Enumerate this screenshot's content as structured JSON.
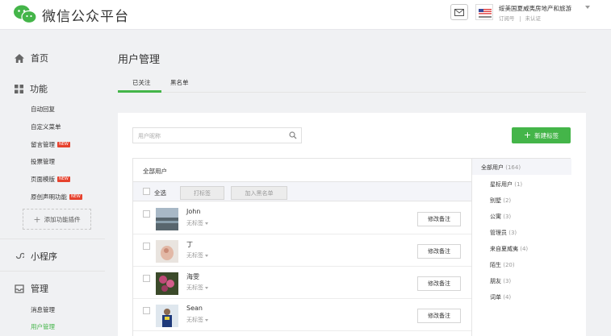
{
  "header": {
    "title": "微信公众平台",
    "account_name": "绥美国夏威夷房地产和旅游",
    "account_type": "订阅号",
    "account_status": "未认证"
  },
  "sidebar": {
    "home": "首页",
    "features": "功能",
    "feature_items": [
      {
        "label": "自动回复"
      },
      {
        "label": "自定义菜单"
      },
      {
        "label": "留言管理",
        "badge": "NEW"
      },
      {
        "label": "投票管理"
      },
      {
        "label": "页面模版",
        "badge": "NEW"
      },
      {
        "label": "原创声明功能",
        "badge": "NEW"
      }
    ],
    "add_plugin": "添加功能插件",
    "mini_program": "小程序",
    "manage": "管理",
    "manage_items": [
      {
        "label": "消息管理"
      },
      {
        "label": "用户管理"
      }
    ]
  },
  "main": {
    "title": "用户管理",
    "tabs": [
      "已关注",
      "黑名单"
    ],
    "search_placeholder": "用户昵称",
    "new_tag_button": "新建标签",
    "list_title": "全部用户",
    "select_all": "全选",
    "tag_button": "打标签",
    "blacklist_button": "加入黑名单",
    "users": [
      {
        "name": "John",
        "tag": "无标签",
        "action": "修改备注"
      },
      {
        "name": "丁",
        "tag": "无标签",
        "action": "修改备注"
      },
      {
        "name": "海雯",
        "tag": "无标签",
        "action": "修改备注"
      },
      {
        "name": "Sean",
        "tag": "无标签",
        "action": "修改备注"
      }
    ]
  },
  "tag_panel": {
    "all_label": "全部用户",
    "all_count": "(164)",
    "tags": [
      {
        "name": "星标用户",
        "count": "(1)"
      },
      {
        "name": "别墅",
        "count": "(2)"
      },
      {
        "name": "公寓",
        "count": "(3)"
      },
      {
        "name": "管理员",
        "count": "(3)"
      },
      {
        "name": "来自夏威夷",
        "count": "(4)"
      },
      {
        "name": "陌生",
        "count": "(20)"
      },
      {
        "name": "朋友",
        "count": "(3)"
      },
      {
        "name": "词单",
        "count": "(4)"
      }
    ]
  },
  "colors": {
    "accent": "#44b549",
    "badge": "#e6422e"
  }
}
